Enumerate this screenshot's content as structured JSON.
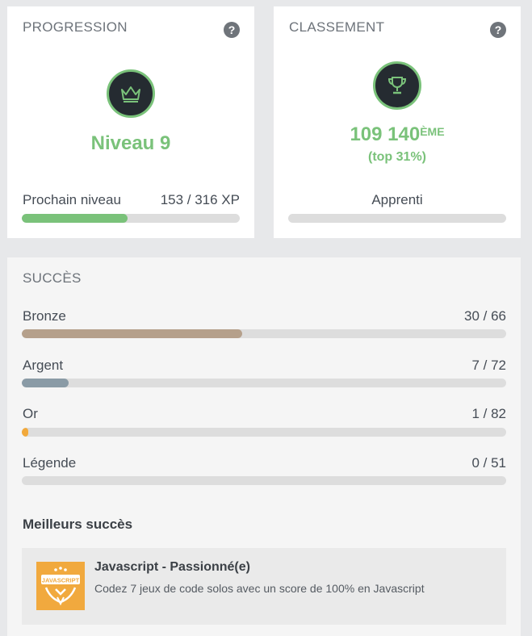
{
  "progression": {
    "title": "PROGRESSION",
    "help": "?",
    "level": "Niveau 9",
    "next_label": "Prochain niveau",
    "xp": "153 / 316 XP",
    "progress_fraction": 0.484,
    "accent": "#7ac27a"
  },
  "classement": {
    "title": "CLASSEMENT",
    "help": "?",
    "rank": "109 140",
    "rank_suffix": "ÈME",
    "top": "(top 31%)",
    "tier": "Apprenti",
    "progress_fraction": 0
  },
  "succes": {
    "title": "SUCCÈS",
    "rows": [
      {
        "label": "Bronze",
        "value": "30 / 66",
        "fraction": 0.4545,
        "color": "#b5a08b"
      },
      {
        "label": "Argent",
        "value": "7 / 72",
        "fraction": 0.0972,
        "color": "#8a9ba6"
      },
      {
        "label": "Or",
        "value": "1 / 82",
        "fraction": 0.0122,
        "color": "#f2a93b"
      },
      {
        "label": "Légende",
        "value": "0 / 51",
        "fraction": 0,
        "color": "#c9a94a"
      }
    ],
    "best_title": "Meilleurs succès",
    "best": {
      "badge_text": "JAVASCRIPT",
      "name": "Javascript - Passionné(e)",
      "description": "Codez 7 jeux de code solos avec un score de 100% en Javascript"
    }
  },
  "icons": {
    "help": "question-mark-icon",
    "level_badge": "crown-icon",
    "rank_badge": "trophy-icon"
  }
}
